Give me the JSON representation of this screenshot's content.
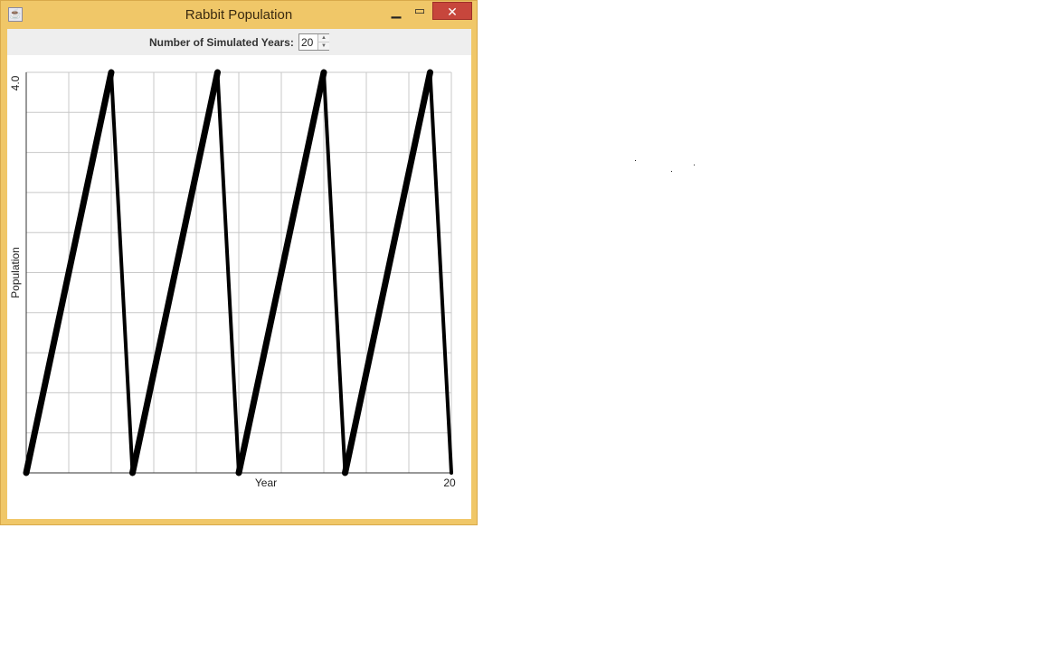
{
  "window": {
    "title": "Rabbit Population",
    "icon": "java-icon",
    "controls": {
      "minimize": "minimize-icon",
      "maximize": "maximize-icon",
      "close": "close-icon"
    }
  },
  "controls": {
    "years_label": "Number of Simulated Years:",
    "years_value": "20"
  },
  "chart_data": {
    "type": "line",
    "xlabel": "Year",
    "ylabel": "Population",
    "x_tick_labels": [
      "20"
    ],
    "y_tick_labels": [
      "4.0"
    ],
    "xlim": [
      0,
      20
    ],
    "ylim": [
      0,
      4.0
    ],
    "grid": true,
    "series": [
      {
        "x": [
          0,
          4,
          5,
          9,
          10,
          14,
          15,
          19,
          20
        ],
        "y": [
          0,
          4,
          0,
          4,
          0,
          4,
          0,
          4,
          0
        ]
      }
    ]
  }
}
